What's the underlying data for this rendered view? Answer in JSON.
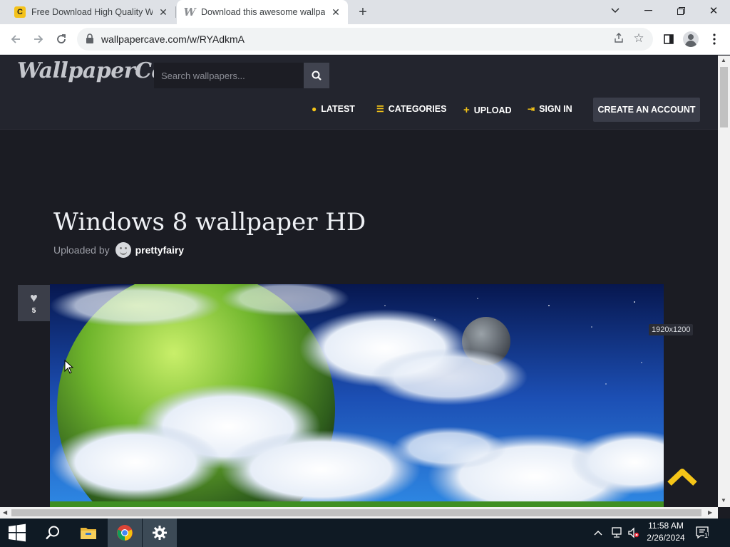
{
  "browser": {
    "tabs": [
      {
        "title": "Free Download High Quality Win",
        "favicon": "C"
      },
      {
        "title": "Download this awesome wallpap",
        "favicon": "W"
      }
    ],
    "address": "wallpapercave.com/w/RYAdkmA"
  },
  "site": {
    "logo": "WallpaperCave",
    "search_placeholder": "Search wallpapers...",
    "nav": [
      {
        "label": "LATEST",
        "icon": "clock-icon"
      },
      {
        "label": "CATEGORIES",
        "icon": "list-icon"
      },
      {
        "label": "UPLOAD",
        "icon": "plus-icon"
      },
      {
        "label": "SIGN IN",
        "icon": "sign-in-icon"
      }
    ],
    "create_account": "CREATE AN ACCOUNT",
    "accent": "#f5c518"
  },
  "wallpaper": {
    "title": "Windows 8 wallpaper HD",
    "uploaded_by_label": "Uploaded by",
    "uploader": "prettyfairy",
    "likes": "5",
    "resolution": "1920x1200"
  },
  "taskbar": {
    "time": "11:58 AM",
    "date": "2/26/2024",
    "notifications": "1"
  }
}
